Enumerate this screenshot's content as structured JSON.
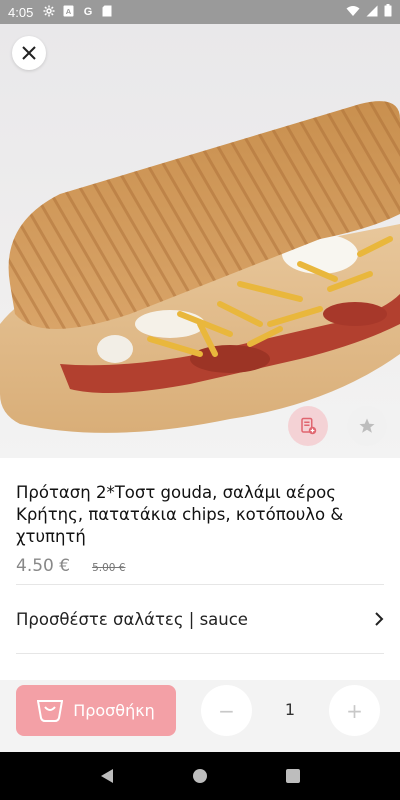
{
  "status_bar": {
    "time": "4:05",
    "left_icons": [
      "gear-icon",
      "a-icon",
      "google-g-icon",
      "sd-card-icon"
    ],
    "right_icons": [
      "wifi-icon",
      "signal-icon",
      "battery-icon"
    ]
  },
  "hero": {
    "image_subject": "toasted sandwich with gouda, salami, potato chips and chicken",
    "close_icon": "close-icon",
    "note_icon": "note-add-icon",
    "favorite_icon": "star-icon"
  },
  "product": {
    "title": "Πρόταση 2*Τοστ gouda, σαλάμι αέρος Κρήτης, πατατάκια chips, κοτόπουλο & χτυπητή",
    "price": "4.50 €",
    "old_price": "5.00 €"
  },
  "options": {
    "label": "Προσθέστε σαλάτες | sauce"
  },
  "cart": {
    "add_label": "Προσθήκη",
    "minus_label": "−",
    "plus_label": "+",
    "quantity": "1"
  },
  "colors": {
    "accent": "#f3a0a6",
    "status_bar": "#9a9a9a"
  }
}
